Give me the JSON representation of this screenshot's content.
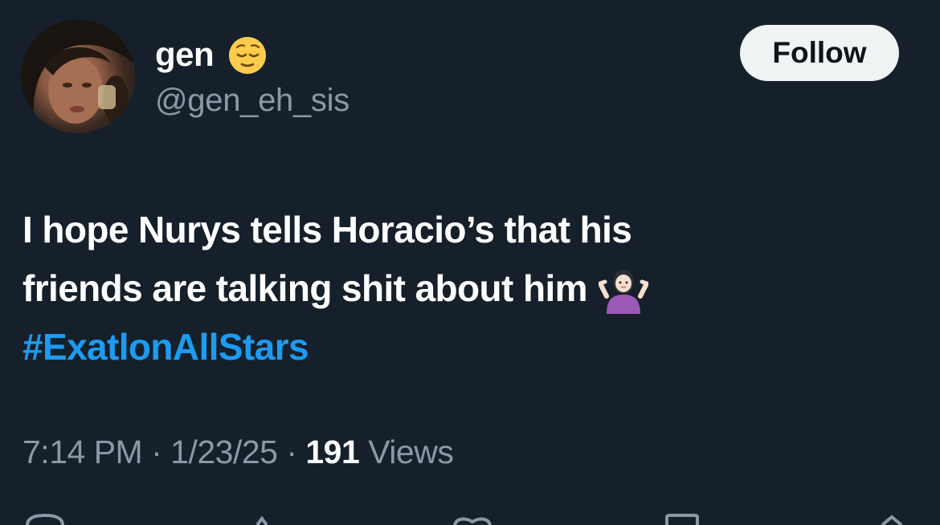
{
  "author": {
    "display_name": "gen",
    "name_emoji_icon": "relieved-face-emoji",
    "handle": "@gen_eh_sis",
    "avatar_icon": "profile-photo"
  },
  "follow_button": {
    "label": "Follow"
  },
  "tweet": {
    "line1": "I hope Nurys tells Horacio’s that his",
    "line2": "friends are talking shit about him",
    "line2_emoji_icon": "woman-shrugging-emoji",
    "hashtag": "#ExatlonAllStars"
  },
  "meta": {
    "time": "7:14 PM",
    "sep1": " · ",
    "date": "1/23/25",
    "sep2": " · ",
    "views_count": "191",
    "views_label": " Views"
  },
  "actions": {
    "icons": [
      "reply-icon",
      "retweet-icon",
      "like-icon",
      "bookmark-icon",
      "share-icon"
    ]
  },
  "colors": {
    "background": "#15202b",
    "text": "#ffffff",
    "secondary": "#8b98a5",
    "link": "#1d9bf0",
    "button_bg": "#eff3f4"
  }
}
